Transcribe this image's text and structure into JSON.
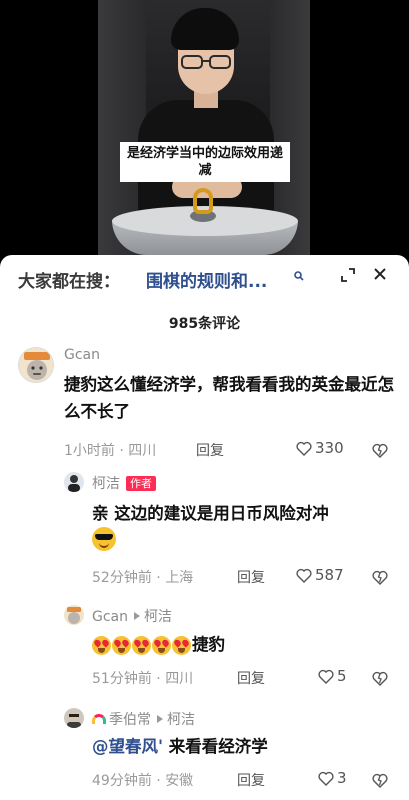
{
  "video": {
    "caption": "是经济学当中的边际效用递减"
  },
  "search": {
    "label": "大家都在搜：",
    "query": "围棋的规则和..."
  },
  "comments_header": {
    "count_label": "985条评论"
  },
  "comments": [
    {
      "username": "Gcan",
      "text": "捷豹这么懂经济学，帮我看看我的英金最近怎么不长了",
      "time": "1小时前",
      "location": "四川",
      "reply_label": "回复",
      "likes": "330"
    },
    {
      "username": "柯洁",
      "badge": "作者",
      "text": "亲 这边的建议是用日币风险对冲",
      "time": "52分钟前",
      "location": "上海",
      "reply_label": "回复",
      "likes": "587"
    },
    {
      "username": "Gcan",
      "reply_to": "柯洁",
      "text": "捷豹",
      "time": "51分钟前",
      "location": "四川",
      "reply_label": "回复",
      "likes": "5"
    },
    {
      "username": "季伯常",
      "reply_to": "柯洁",
      "mention": "@望春风'",
      "text": " 来看看经济学",
      "time": "49分钟前",
      "location": "安徽",
      "reply_label": "回复",
      "likes": "3"
    }
  ],
  "icons": {
    "search": "search-icon",
    "expand": "expand-icon",
    "close": "close-icon",
    "like": "heart-outline-icon",
    "dislike": "broken-heart-icon"
  },
  "colors": {
    "link": "#2f4f8f",
    "badge": "#fe2c55",
    "meta": "#9a9a9a"
  }
}
